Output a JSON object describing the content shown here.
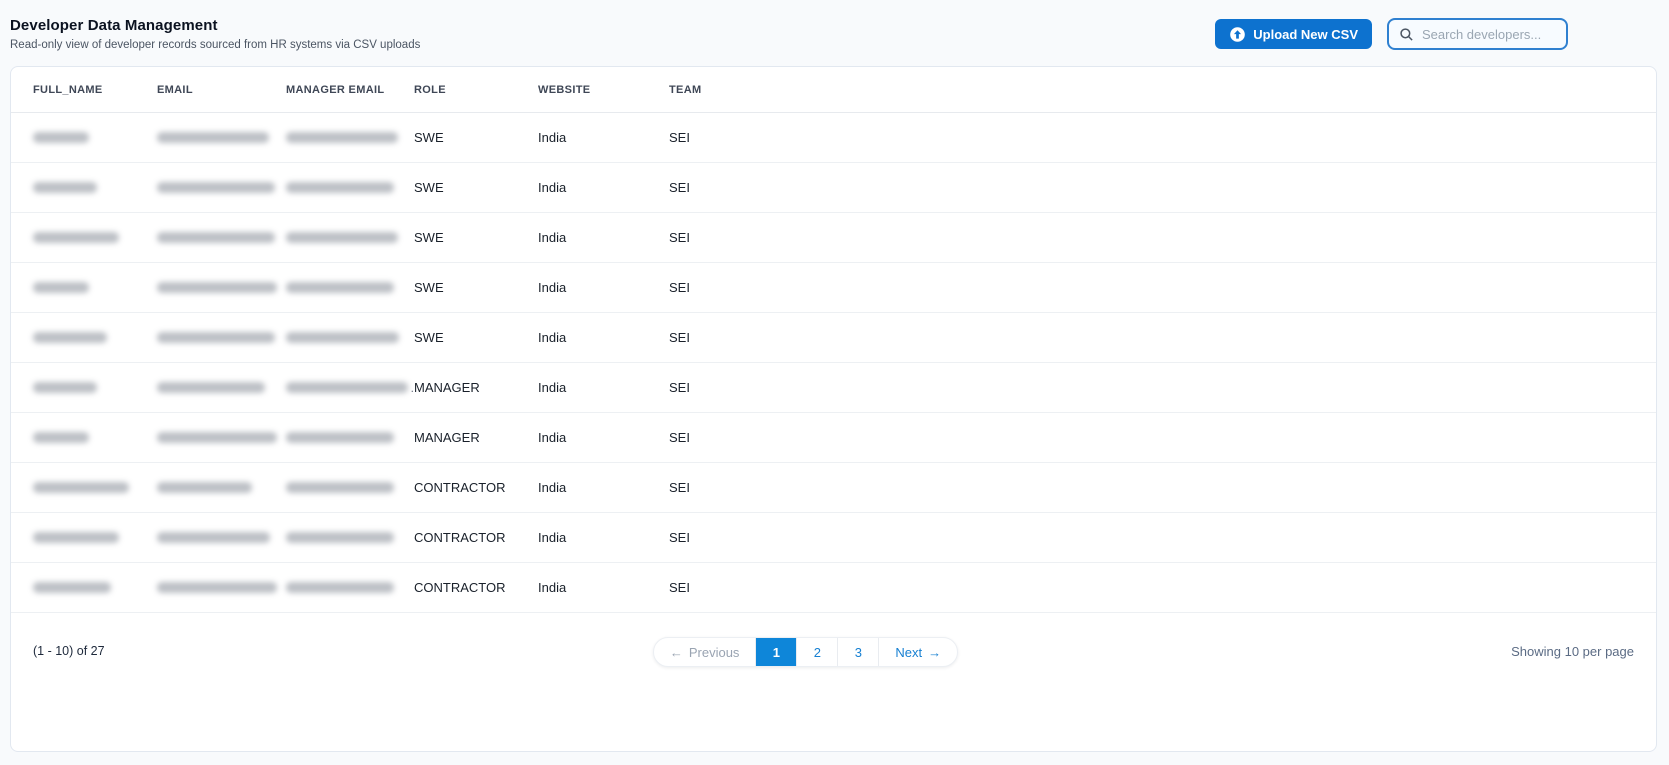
{
  "page": {
    "title": "Developer Data Management",
    "subtitle": "Read-only view of developer records sourced from HR systems via CSV uploads"
  },
  "toolbar": {
    "upload_button_label": "Upload New CSV",
    "upload_icon": "arrow-up-circle-icon",
    "search_placeholder": "Search developers...",
    "search_value": "",
    "search_icon": "magnifier-icon"
  },
  "table": {
    "columns": [
      "FULL_NAME",
      "EMAIL",
      "MANAGER EMAIL",
      "ROLE",
      "WEBSITE",
      "TEAM"
    ],
    "redaction_note": "full_name, email and manager email cells are blurred/redacted in the source pixels",
    "rows": [
      {
        "full_name_redacted": true,
        "name_w": 56,
        "email_w": 112,
        "manager_w": 112,
        "manager_suffix": "",
        "role": "SWE",
        "website": "India",
        "team": "SEI"
      },
      {
        "full_name_redacted": true,
        "name_w": 64,
        "email_w": 118,
        "manager_w": 108,
        "manager_suffix": "",
        "role": "SWE",
        "website": "India",
        "team": "SEI"
      },
      {
        "full_name_redacted": true,
        "name_w": 86,
        "email_w": 118,
        "manager_w": 112,
        "manager_suffix": "",
        "role": "SWE",
        "website": "India",
        "team": "SEI"
      },
      {
        "full_name_redacted": true,
        "name_w": 56,
        "email_w": 120,
        "manager_w": 108,
        "manager_suffix": "",
        "role": "SWE",
        "website": "India",
        "team": "SEI"
      },
      {
        "full_name_redacted": true,
        "name_w": 74,
        "email_w": 118,
        "manager_w": 113,
        "manager_suffix": "",
        "role": "SWE",
        "website": "India",
        "team": "SEI"
      },
      {
        "full_name_redacted": true,
        "name_w": 64,
        "email_w": 108,
        "manager_w": 124,
        "manager_suffix": ".",
        "role": "MANAGER",
        "website": "India",
        "team": "SEI"
      },
      {
        "full_name_redacted": true,
        "name_w": 56,
        "email_w": 120,
        "manager_w": 108,
        "manager_suffix": "",
        "role": "MANAGER",
        "website": "India",
        "team": "SEI"
      },
      {
        "full_name_redacted": true,
        "name_w": 96,
        "email_w": 95,
        "manager_w": 108,
        "manager_suffix": "",
        "role": "CONTRACTOR",
        "website": "India",
        "team": "SEI"
      },
      {
        "full_name_redacted": true,
        "name_w": 86,
        "email_w": 113,
        "manager_w": 108,
        "manager_suffix": "",
        "role": "CONTRACTOR",
        "website": "India",
        "team": "SEI"
      },
      {
        "full_name_redacted": true,
        "name_w": 78,
        "email_w": 120,
        "manager_w": 108,
        "manager_suffix": "",
        "role": "CONTRACTOR",
        "website": "India",
        "team": "SEI"
      }
    ]
  },
  "footer": {
    "range_label": "(1 - 10) of 27",
    "per_page_label": "Showing 10 per page",
    "pagination": {
      "prev_arrow": "←",
      "prev_label": "Previous",
      "pages": [
        "1",
        "2",
        "3"
      ],
      "active_page": "1",
      "next_label": "Next",
      "next_arrow": "→"
    }
  },
  "colors": {
    "primary_button": "#0d72cf",
    "pagination_active": "#0e86d9",
    "link_blue": "#1780d2",
    "search_border": "#2f80d0",
    "page_background": "#f8fafc",
    "card_border": "#e2e8f0"
  }
}
